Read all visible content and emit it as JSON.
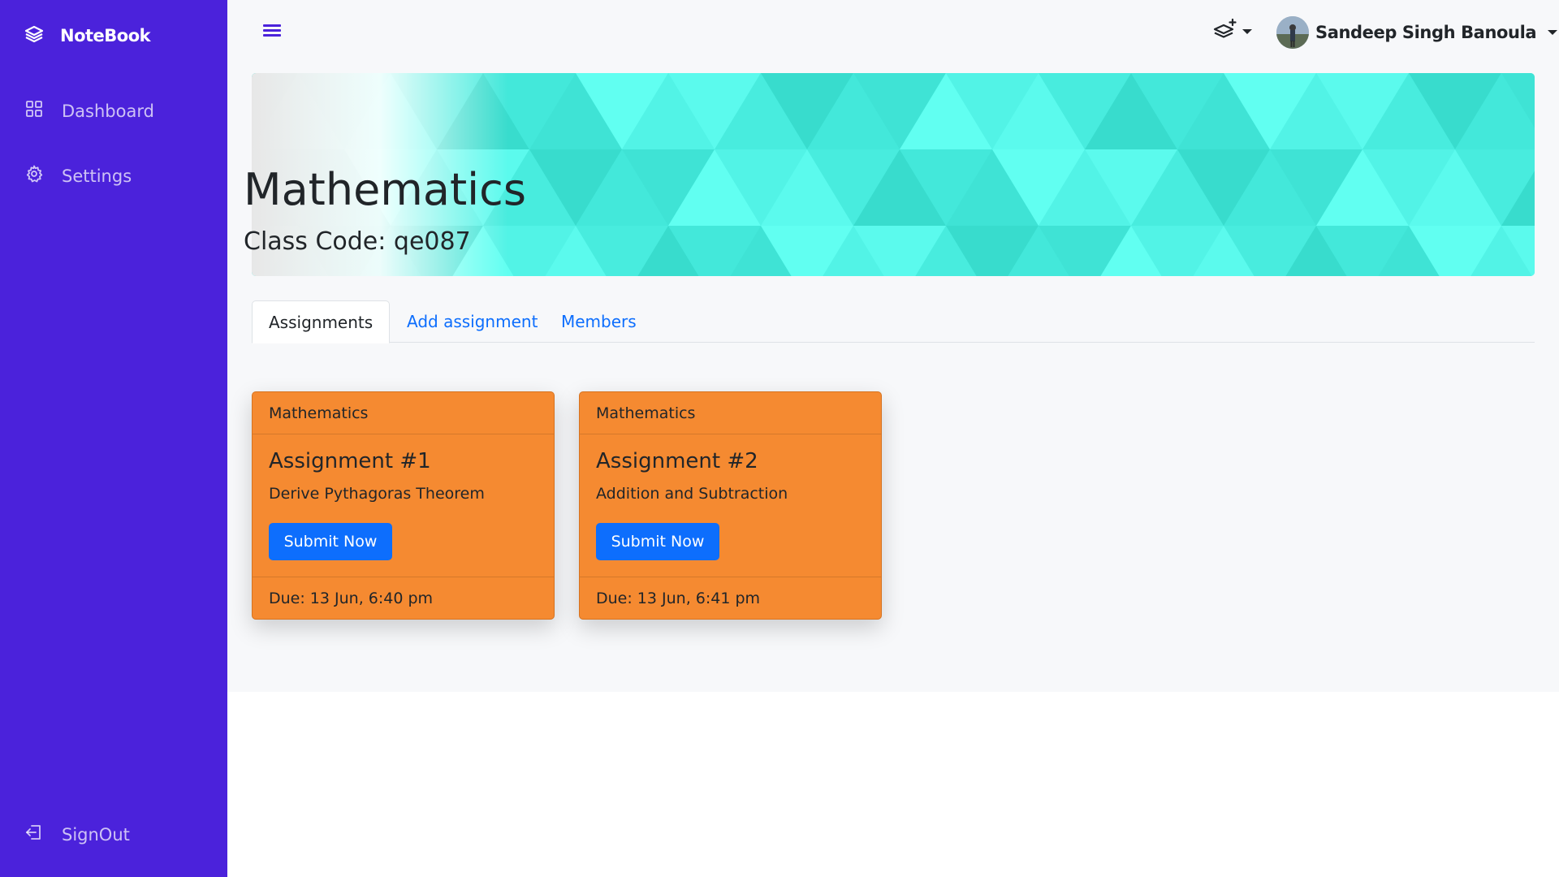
{
  "sidebar": {
    "brand": "NoteBook",
    "items": [
      {
        "label": "Dashboard",
        "icon": "grid-icon"
      },
      {
        "label": "Settings",
        "icon": "gear-icon"
      }
    ],
    "signout": {
      "label": "SignOut",
      "icon": "sign-out-icon"
    }
  },
  "header": {
    "user_name": "Sandeep Singh Banoula"
  },
  "banner": {
    "title": "Mathematics",
    "class_code": "Class Code: qe087"
  },
  "tabs": [
    {
      "label": "Assignments",
      "active": true
    },
    {
      "label": "Add assignment",
      "active": false
    },
    {
      "label": "Members",
      "active": false
    }
  ],
  "assignments": [
    {
      "subject": "Mathematics",
      "title": "Assignment #1",
      "description": "Derive Pythagoras Theorem",
      "button": "Submit Now",
      "due": "Due: 13 Jun, 6:40 pm"
    },
    {
      "subject": "Mathematics",
      "title": "Assignment #2",
      "description": "Addition and Subtraction",
      "button": "Submit Now",
      "due": "Due: 13 Jun, 6:41 pm"
    }
  ],
  "colors": {
    "sidebar": "#4b22db",
    "card": "#f58a31",
    "primary": "#0d6efd",
    "banner": "#4aeee0"
  }
}
